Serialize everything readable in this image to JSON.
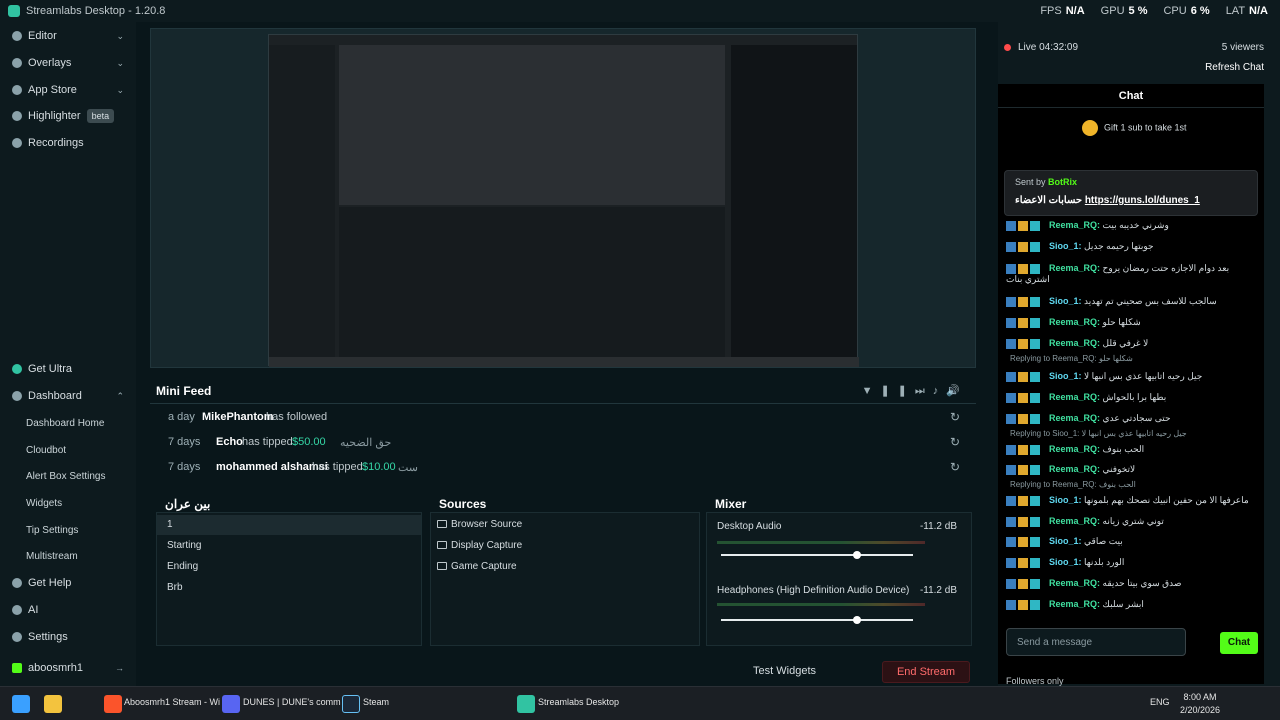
{
  "titlebar": {
    "app_title": "Streamlabs Desktop - 1.20.8"
  },
  "metrics": {
    "fps_label": "FPS",
    "fps": "N/A",
    "gpu_label": "GPU",
    "gpu": "5 %",
    "cpu_label": "CPU",
    "cpu": "6 %",
    "lat_label": "LAT",
    "lat": "N/A"
  },
  "sidebar": {
    "top": [
      {
        "label": "Editor"
      },
      {
        "label": "Overlays"
      },
      {
        "label": "App Store"
      },
      {
        "label": "Highlighter",
        "badge": "beta"
      },
      {
        "label": "Recordings"
      }
    ],
    "get_ultra": "Get Ultra",
    "dashboard": "Dashboard",
    "dashboard_items": [
      "Dashboard Home",
      "Cloudbot",
      "Alert Box Settings",
      "Widgets",
      "Tip Settings",
      "Multistream"
    ],
    "get_help": "Get Help",
    "ai": "AI",
    "settings": "Settings",
    "user": "aboosmrh1"
  },
  "mini_feed": {
    "title": "Mini Feed",
    "rows": [
      {
        "when": "a day",
        "who": "MikePhantom",
        "what": "has followed",
        "amount": "",
        "message": ""
      },
      {
        "when": "7 days",
        "who": "Echo",
        "what": "has tipped",
        "amount": "$50.00",
        "message": "حق الضحيه"
      },
      {
        "when": "7 days",
        "who": "mohammed alshamsi",
        "what": "has tipped",
        "amount": "$10.00",
        "message": "ست"
      }
    ]
  },
  "scenes": {
    "title": "بين عران",
    "items": [
      "1",
      "Starting",
      "Ending",
      "Brb"
    ]
  },
  "sources": {
    "title": "Sources",
    "items": [
      "Browser Source",
      "Display Capture",
      "Game Capture"
    ]
  },
  "mixer": {
    "title": "Mixer",
    "tracks": [
      {
        "name": "Desktop Audio",
        "db": "-11.2 dB",
        "level": 0.71
      },
      {
        "name": "Headphones (High Definition Audio Device)",
        "db": "-11.2 dB",
        "level": 0.71
      }
    ]
  },
  "bottom": {
    "test_widgets": "Test Widgets",
    "end_stream": "End Stream"
  },
  "live": {
    "status": "Live 04:32:09",
    "viewers": "5 viewers",
    "refresh": "Refresh Chat"
  },
  "chat": {
    "title": "Chat",
    "gift": "Gift 1 sub to take 1st",
    "pinned_by_label": "Sent by",
    "pinned_by": "BotRix",
    "pinned_text": "حسابات الاعضاء",
    "pinned_link": "https://guns.lol/dunes_1",
    "messages": [
      {
        "user": "Reema_RQ:",
        "text": "وشرني خديبه بيت"
      },
      {
        "user": "Sioo_1:",
        "text": "جوبتها رحيمه جديل"
      },
      {
        "user": "Reema_RQ:",
        "text": "بعد دوام الاجازه حتت رمضان يروح اشتري بنات"
      },
      {
        "user": "Sioo_1:",
        "text": "سالجب للاسف بس صحيني تم تهديد"
      },
      {
        "user": "Reema_RQ:",
        "text": "شكلها حلو"
      },
      {
        "user": "Reema_RQ:",
        "text": "لا غرفي قلل"
      },
      {
        "user": "Sioo_1:",
        "text": "جيل رحيه اتابيها عذي بس انبها لا"
      },
      {
        "user": "Reema_RQ:",
        "text": "بطها برا بالحواش"
      },
      {
        "user": "Reema_RQ:",
        "text": "حتى سجادتي عدي"
      },
      {
        "user": "Reema_RQ:",
        "text": "الحب بنوف"
      },
      {
        "user": "Reema_RQ:",
        "text": "لاتخوفني"
      },
      {
        "user": "Sioo_1:",
        "text": "ماعرفها الا من حفين انبيك نصحك بهم بلمونها"
      },
      {
        "user": "Reema_RQ:",
        "text": "توني شتري زيانه"
      },
      {
        "user": "Sioo_1:",
        "text": "بيت صاقي"
      },
      {
        "user": "Sioo_1:",
        "text": "الورد بلدنها"
      },
      {
        "user": "Reema_RQ:",
        "text": "صدق سوي بيتا حديقه"
      },
      {
        "user": "Reema_RQ:",
        "text": "ابشر سلبك"
      }
    ],
    "replies": [
      "Replying to Reema_RQ: شكلها حلو",
      "Replying to Sioo_1: جيل رحيه اتابيها عذي بس انبها لا",
      "Replying to Reema_RQ: الحب بنوف"
    ],
    "followers_only": "Followers only",
    "input_placeholder": "Send a message",
    "send": "Chat"
  },
  "colors": {
    "accent": "#31c3a2",
    "live": "#ff4b4b",
    "kick": "#53fc18",
    "tip": "#35d6a6"
  },
  "taskbar": {
    "apps": [
      "Aboosmrh1 Stream - Wi",
      "DUNES | DUNE's comm",
      "Steam",
      "Streamlabs Desktop"
    ],
    "lang": "ENG",
    "time": "8:00 AM",
    "date": "2/20/2026"
  }
}
